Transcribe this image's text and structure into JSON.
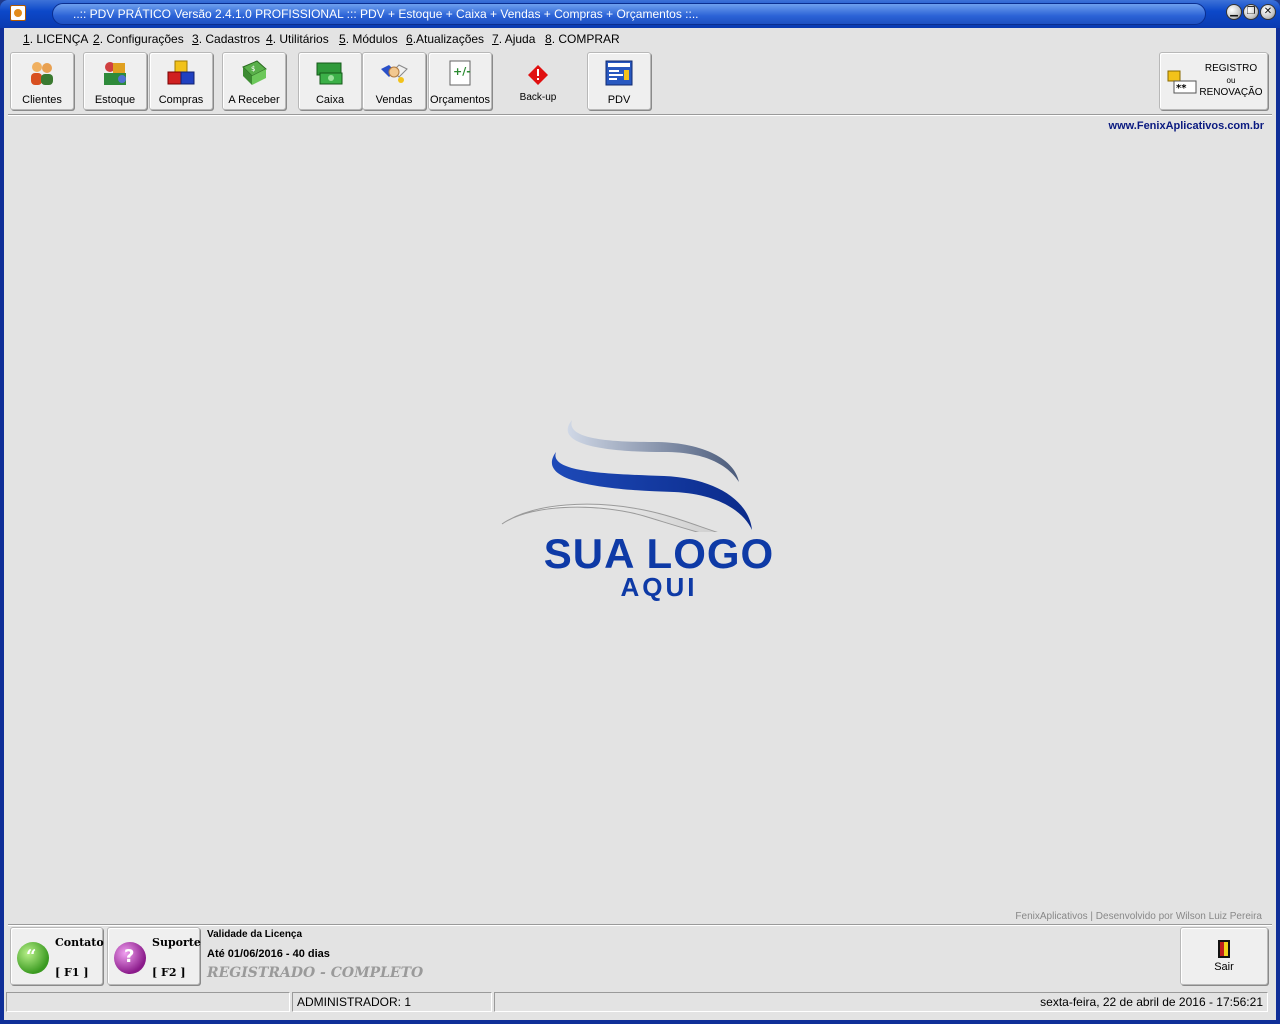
{
  "window": {
    "title": "..:: PDV PRÁTICO Versão 2.4.1.0  PROFISSIONAL ::: PDV + Estoque + Caixa + Vendas + Compras + Orçamentos ::..",
    "buttons": {
      "minimize": "▁",
      "restore": "❐",
      "close": "✕"
    }
  },
  "menu": [
    {
      "acc": "1",
      "label": ". LICENÇA"
    },
    {
      "acc": "2",
      "label": ". Configurações"
    },
    {
      "acc": "3",
      "label": ". Cadastros"
    },
    {
      "acc": "4",
      "label": ". Utilitários"
    },
    {
      "acc": "5",
      "label": ". Módulos"
    },
    {
      "acc": "6",
      "label": ".Atualizações"
    },
    {
      "acc": "7",
      "label": ". Ajuda"
    },
    {
      "acc": "8",
      "label": ". COMPRAR"
    }
  ],
  "toolbar": {
    "clientes": "Clientes",
    "estoque": "Estoque",
    "compras": "Compras",
    "a_receber": "A Receber",
    "caixa": "Caixa",
    "vendas": "Vendas",
    "orcamentos": "Orçamentos",
    "backup": "Back-up",
    "pdv": "PDV",
    "registro_line1": "REGISTRO",
    "registro_line2": "ou",
    "registro_line3": "RENOVAÇÃO"
  },
  "website": "www.FenixAplicativos.com.br",
  "logo": {
    "line1": "SUA LOGO",
    "line2": "AQUI"
  },
  "credit": "FenixAplicativos | Desenvolvido por Wilson Luiz Pereira",
  "bottom": {
    "contato_label": "Contato",
    "contato_key": "[ F1 ]",
    "suporte_label": "Suporte",
    "suporte_key": "[ F2 ]",
    "license_title": "Validade da Licença",
    "license_date": "Até 01/06/2016 - 40 dias",
    "license_status": "REGISTRADO - COMPLETO",
    "sair": "Sair"
  },
  "status": {
    "user": "ADMINISTRADOR: 1",
    "datetime": "sexta-feira, 22 de abril de 2016 - 17:56:21"
  },
  "colors": {
    "title_bar": "#0c48c9",
    "client_bg": "#e3e3e3",
    "logo_blue": "#0e3aa6",
    "website": "#0a1a80"
  }
}
